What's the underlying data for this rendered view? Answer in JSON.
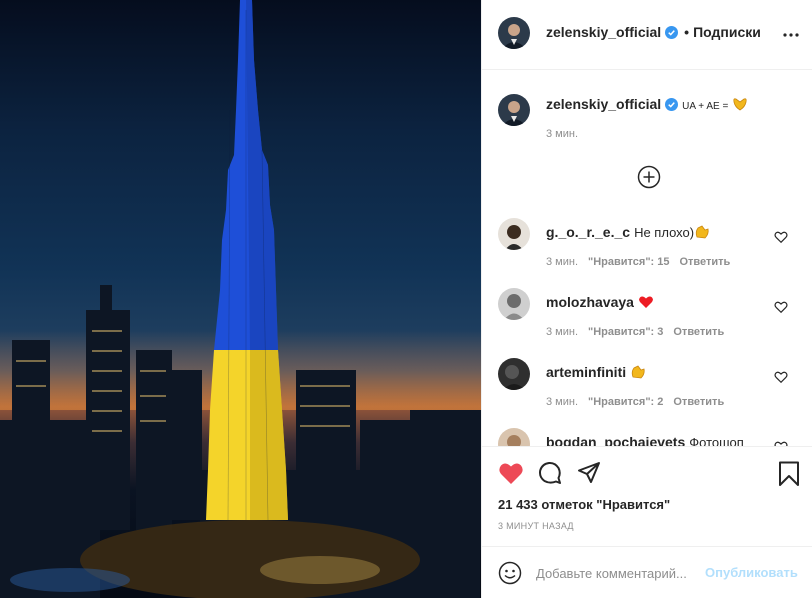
{
  "post": {
    "author": "zelenskiy_official",
    "follow_separator": "•",
    "follow_label": "Подписки",
    "caption_text": "UA + AE =",
    "caption_time": "3 мин.",
    "likes": "21 433 отметок \"Нравится\"",
    "posted": "3 МИНУТ НАЗАД",
    "liked": true
  },
  "comments": [
    {
      "user": "g._o._r._e._c",
      "text": "Не плохо)",
      "emoji": "clap-hands",
      "time": "3 мин.",
      "likes_label": "\"Нравится\": 15",
      "reply": "Ответить"
    },
    {
      "user": "molozhavaya",
      "text": "",
      "emoji": "red-heart",
      "time": "3 мин.",
      "likes_label": "\"Нравится\": 3",
      "reply": "Ответить"
    },
    {
      "user": "arteminfiniti",
      "text": "",
      "emoji": "clap-hands",
      "time": "3 мин.",
      "likes_label": "\"Нравится\": 2",
      "reply": "Ответить"
    },
    {
      "user": "bogdan_pochaievets",
      "text": "Фотошоп",
      "emoji": "",
      "time": "",
      "likes_label": "",
      "reply": ""
    }
  ],
  "composer": {
    "placeholder": "Добавьте комментарий...",
    "publish_label": "Опубликовать"
  },
  "colors": {
    "like_red": "#ed4956",
    "verified_blue": "#3897f0",
    "publish_disabled": "#b2dffc",
    "ukraine_blue": "#1e4fd8",
    "ukraine_yellow": "#f4d42a"
  },
  "icons": [
    "more-icon",
    "verified-icon",
    "plus-circle-icon",
    "heart-icon",
    "comment-icon",
    "share-icon",
    "bookmark-icon",
    "smiley-icon"
  ]
}
